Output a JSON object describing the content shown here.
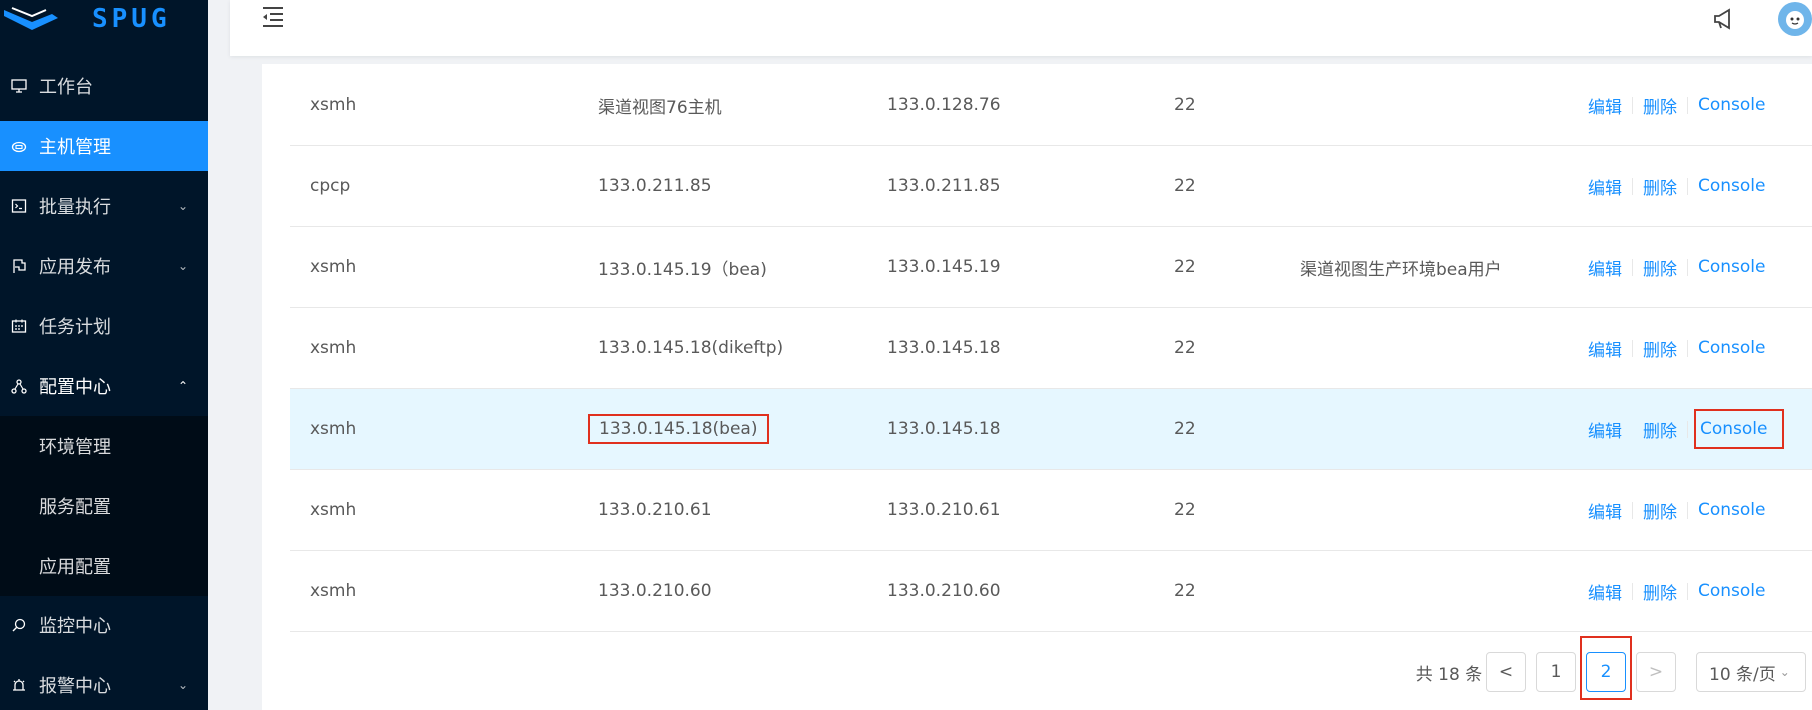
{
  "app": {
    "logo_text": "SPUG"
  },
  "sidebar": {
    "items": [
      {
        "label": "工作台",
        "icon": "desktop-icon"
      },
      {
        "label": "主机管理",
        "icon": "cloud-server-icon",
        "active": true
      },
      {
        "label": "批量执行",
        "icon": "code-icon",
        "expandable": true
      },
      {
        "label": "应用发布",
        "icon": "flag-icon",
        "expandable": true
      },
      {
        "label": "任务计划",
        "icon": "schedule-icon"
      },
      {
        "label": "配置中心",
        "icon": "deployment-icon",
        "expanded": true
      },
      {
        "label": "监控中心",
        "icon": "monitor-icon"
      },
      {
        "label": "报警中心",
        "icon": "alert-icon",
        "expandable": true
      }
    ],
    "config_sub": [
      "环境管理",
      "服务配置",
      "应用配置"
    ]
  },
  "header": {
    "toggle_icon": "menu-fold-icon",
    "notice_icon": "notification-icon",
    "avatar_icon": "avatar"
  },
  "table": {
    "rows": [
      {
        "zone": "xsmh",
        "name": "渠道视图76主机",
        "ip": "133.0.128.76",
        "port": "22",
        "desc": ""
      },
      {
        "zone": "cpcp",
        "name": "133.0.211.85",
        "ip": "133.0.211.85",
        "port": "22",
        "desc": ""
      },
      {
        "zone": "xsmh",
        "name": "133.0.145.19（bea)",
        "ip": "133.0.145.19",
        "port": "22",
        "desc": "渠道视图生产环境bea用户"
      },
      {
        "zone": "xsmh",
        "name": "133.0.145.18(dikeftp)",
        "ip": "133.0.145.18",
        "port": "22",
        "desc": ""
      },
      {
        "zone": "xsmh",
        "name": "133.0.145.18(bea)",
        "ip": "133.0.145.18",
        "port": "22",
        "desc": "",
        "highlight": true
      },
      {
        "zone": "xsmh",
        "name": "133.0.210.61",
        "ip": "133.0.210.61",
        "port": "22",
        "desc": ""
      },
      {
        "zone": "xsmh",
        "name": "133.0.210.60",
        "ip": "133.0.210.60",
        "port": "22",
        "desc": ""
      }
    ],
    "actions": {
      "edit": "编辑",
      "delete": "删除",
      "console": "Console"
    }
  },
  "pagination": {
    "total": "共 18 条",
    "prev": "<",
    "pages": [
      "1",
      "2"
    ],
    "current_page": "2",
    "next": ">",
    "page_size": "10 条/页"
  },
  "colors": {
    "sidebar_bg": "#001529",
    "accent": "#1890ff",
    "highlight_row": "#e6f7ff",
    "annotation_red": "#e0301e"
  }
}
